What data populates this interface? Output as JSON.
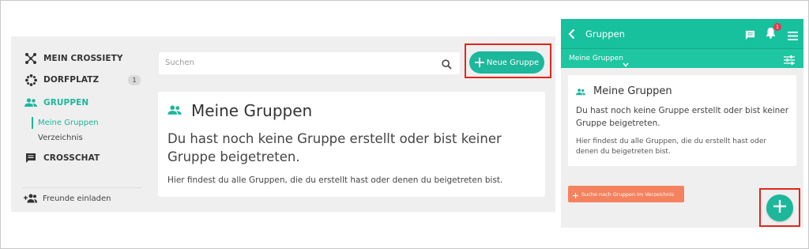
{
  "colors": {
    "accent": "#1db79b",
    "header": "#17c19e",
    "highlight": "#e2261c",
    "secondary_button": "#f5825e",
    "badge_red": "#e8394d"
  },
  "desktop": {
    "sidebar": {
      "items": [
        {
          "label": "MEIN CROSSIETY",
          "icon": "network-icon"
        },
        {
          "label": "DORFPLATZ",
          "icon": "community-circle-icon",
          "badge": "1"
        },
        {
          "label": "GRUPPEN",
          "icon": "groups-icon",
          "active": true
        },
        {
          "label": "CROSSCHAT",
          "icon": "chat-icon"
        }
      ],
      "subitems": [
        {
          "label": "Meine Gruppen",
          "active": true
        },
        {
          "label": "Verzeichnis"
        }
      ],
      "invite_label": "Freunde einladen"
    },
    "search": {
      "placeholder": "Suchen"
    },
    "new_group_label": "Neue Gruppe",
    "card": {
      "title": "Meine Gruppen",
      "message": "Du hast noch keine Gruppe erstellt oder bist keiner Gruppe beigetreten.",
      "hint": "Hier findest du alle Gruppen, die du erstellt hast oder denen du beigetreten bist."
    }
  },
  "mobile": {
    "header_title": "Gruppen",
    "notification_count": "1",
    "subheader_label": "Meine Gruppen",
    "card": {
      "title": "Meine Gruppen",
      "message": "Du hast noch keine Gruppe erstellt oder bist keiner Gruppe beigetreten.",
      "hint": "Hier findest du alle Gruppen, die du erstellt hast oder denen du beigetreten bist."
    },
    "directory_button_label": "Suche nach Gruppen im Verzeichnis"
  }
}
